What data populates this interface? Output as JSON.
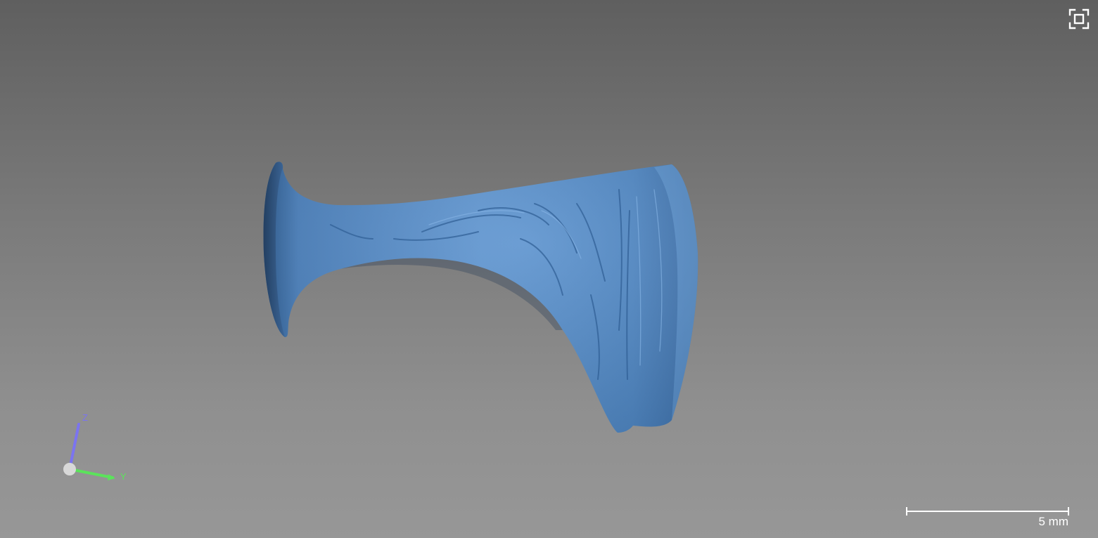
{
  "viewer": {
    "background_top": "#5f5f5f",
    "background_bottom": "#979797",
    "model_color": "#4a82c0",
    "fullscreen_icon": "fullscreen-icon"
  },
  "axes": {
    "z_label": "Z",
    "y_label": "Y",
    "z_color": "#7b74f0",
    "y_color": "#5be35b",
    "origin_color": "#d8d8d8"
  },
  "scale_bar": {
    "label": "5 mm"
  }
}
